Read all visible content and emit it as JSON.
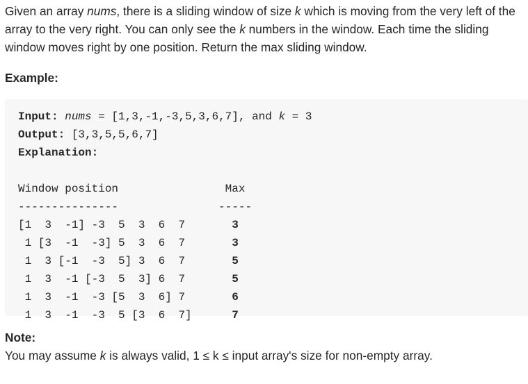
{
  "intro": {
    "part1": "Given an array ",
    "nums_var": "nums",
    "part2": ", there is a sliding window of size ",
    "k_var": "k",
    "part3": " which is moving from the very left of the array to the very right. You can only see the ",
    "k_var2": "k",
    "part4": " numbers in the window. Each time the sliding window moves right by one position. Return the max sliding window."
  },
  "example_heading": "Example:",
  "example": {
    "input_label": "Input:",
    "input_pre": " ",
    "input_nums_var": "nums",
    "input_mid": " = [1,3,-1,-3,5,3,6,7], and ",
    "input_k_var": "k",
    "input_post": " = 3",
    "output_label": "Output:",
    "output_value": " [3,3,5,5,6,7]",
    "explanation_label": "Explanation:",
    "table_header": "Window position                Max",
    "table_divider": "---------------               -----",
    "rows": [
      {
        "window": "[1  3  -1] -3  5  3  6  7       ",
        "max": "3"
      },
      {
        "window": " 1 [3  -1  -3] 5  3  6  7       ",
        "max": "3"
      },
      {
        "window": " 1  3 [-1  -3  5] 3  6  7       ",
        "max": "5"
      },
      {
        "window": " 1  3  -1 [-3  5  3] 6  7       ",
        "max": "5"
      },
      {
        "window": " 1  3  -1  -3 [5  3  6] 7       ",
        "max": "6"
      },
      {
        "window": " 1  3  -1  -3  5 [3  6  7]      ",
        "max": "7"
      }
    ]
  },
  "note_heading": "Note:",
  "note": {
    "part1": "You may assume ",
    "k_var": "k",
    "part2": " is always valid, 1 ≤ k ≤ input array's size for non-empty array."
  }
}
